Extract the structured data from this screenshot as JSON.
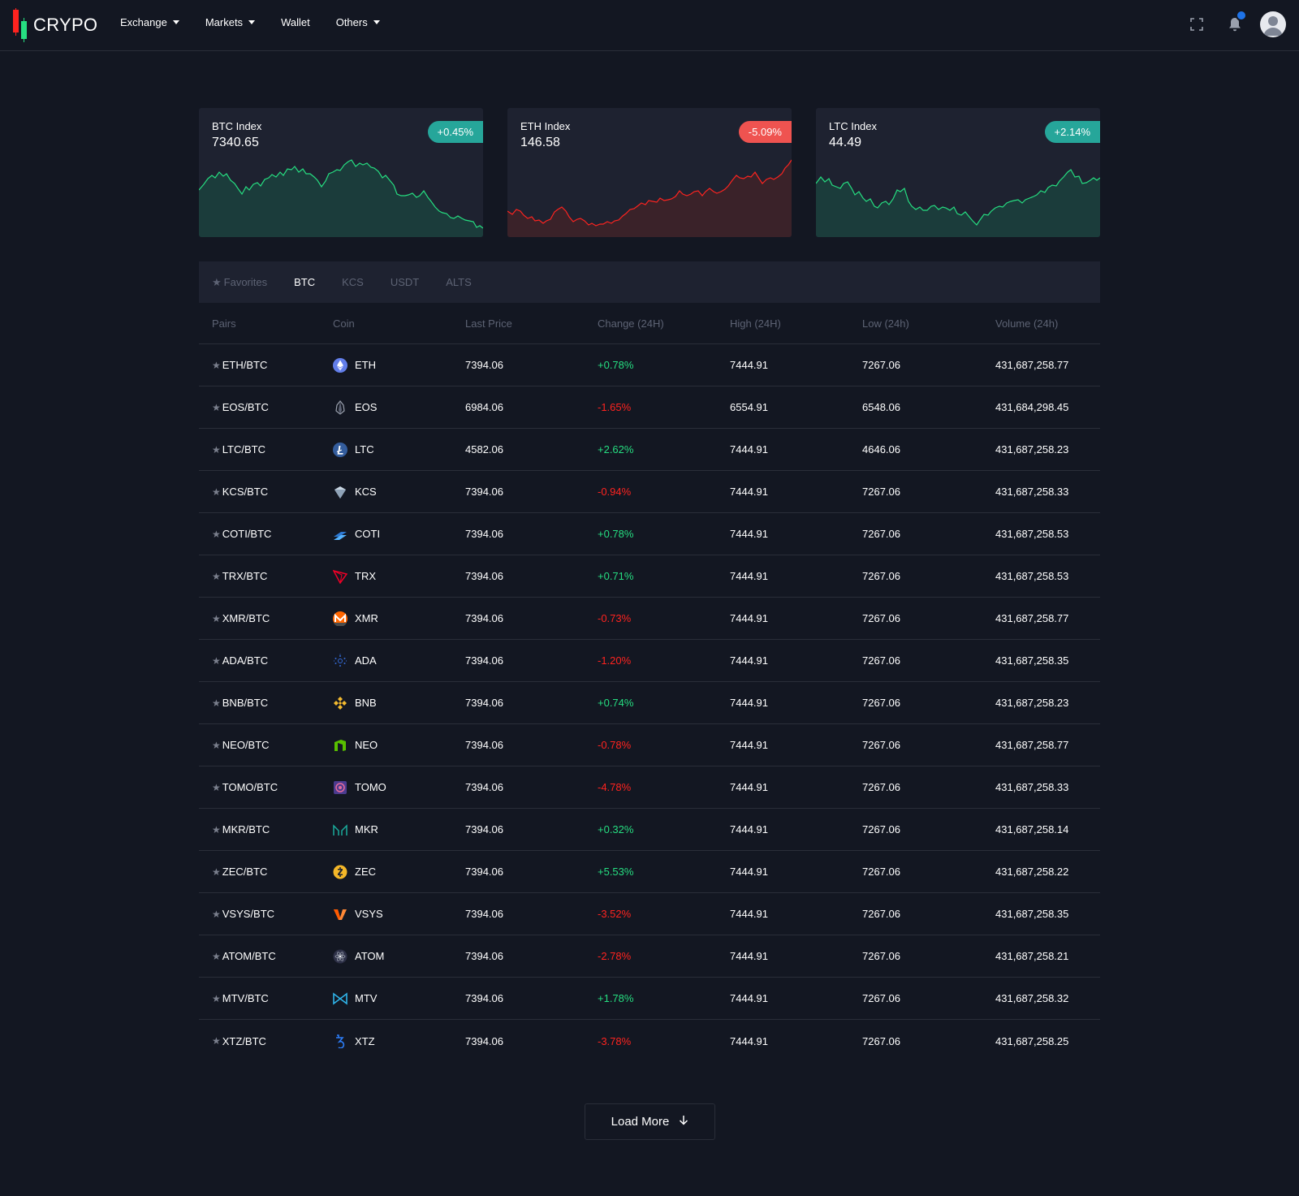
{
  "brand": {
    "name": "CRYPO",
    "red": "#ff231f",
    "green": "#26de81"
  },
  "nav": [
    {
      "label": "Exchange",
      "has_caret": true
    },
    {
      "label": "Markets",
      "has_caret": true
    },
    {
      "label": "Wallet",
      "has_caret": false
    },
    {
      "label": "Others",
      "has_caret": true
    }
  ],
  "header_icons": [
    "fullscreen-icon",
    "bell-icon",
    "user-avatar-icon"
  ],
  "index_cards": [
    {
      "title": "BTC Index",
      "value": "7340.65",
      "change": "+0.45%",
      "direction": "up",
      "color": "#26a69a"
    },
    {
      "title": "ETH Index",
      "value": "146.58",
      "change": "-5.09%",
      "direction": "down",
      "color": "#ef5350"
    },
    {
      "title": "LTC Index",
      "value": "44.49",
      "change": "+2.14%",
      "direction": "up",
      "color": "#26a69a"
    }
  ],
  "tabs": [
    {
      "label": "Favorites",
      "active": false,
      "icon": "star-icon"
    },
    {
      "label": "BTC",
      "active": true
    },
    {
      "label": "KCS",
      "active": false
    },
    {
      "label": "USDT",
      "active": false
    },
    {
      "label": "ALTS",
      "active": false
    }
  ],
  "table": {
    "columns": [
      "Pairs",
      "Coin",
      "Last Price",
      "Change (24H)",
      "High (24H)",
      "Low (24h)",
      "Volume (24h)"
    ],
    "rows": [
      {
        "pair": "ETH/BTC",
        "coin": "ETH",
        "icon": "eth-icon",
        "last": "7394.06",
        "change": "+0.78%",
        "dir": "pos",
        "high": "7444.91",
        "low": "7267.06",
        "volume": "431,687,258.77"
      },
      {
        "pair": "EOS/BTC",
        "coin": "EOS",
        "icon": "eos-icon",
        "last": "6984.06",
        "change": "-1.65%",
        "dir": "neg",
        "high": "6554.91",
        "low": "6548.06",
        "volume": "431,684,298.45"
      },
      {
        "pair": "LTC/BTC",
        "coin": "LTC",
        "icon": "ltc-icon",
        "last": "4582.06",
        "change": "+2.62%",
        "dir": "pos",
        "high": "7444.91",
        "low": "4646.06",
        "volume": "431,687,258.23"
      },
      {
        "pair": "KCS/BTC",
        "coin": "KCS",
        "icon": "kcs-icon",
        "last": "7394.06",
        "change": "-0.94%",
        "dir": "neg",
        "high": "7444.91",
        "low": "7267.06",
        "volume": "431,687,258.33"
      },
      {
        "pair": "COTI/BTC",
        "coin": "COTI",
        "icon": "coti-icon",
        "last": "7394.06",
        "change": "+0.78%",
        "dir": "pos",
        "high": "7444.91",
        "low": "7267.06",
        "volume": "431,687,258.53"
      },
      {
        "pair": "TRX/BTC",
        "coin": "TRX",
        "icon": "trx-icon",
        "last": "7394.06",
        "change": "+0.71%",
        "dir": "pos",
        "high": "7444.91",
        "low": "7267.06",
        "volume": "431,687,258.53"
      },
      {
        "pair": "XMR/BTC",
        "coin": "XMR",
        "icon": "xmr-icon",
        "last": "7394.06",
        "change": "-0.73%",
        "dir": "neg",
        "high": "7444.91",
        "low": "7267.06",
        "volume": "431,687,258.77"
      },
      {
        "pair": "ADA/BTC",
        "coin": "ADA",
        "icon": "ada-icon",
        "last": "7394.06",
        "change": "-1.20%",
        "dir": "neg",
        "high": "7444.91",
        "low": "7267.06",
        "volume": "431,687,258.35"
      },
      {
        "pair": "BNB/BTC",
        "coin": "BNB",
        "icon": "bnb-icon",
        "last": "7394.06",
        "change": "+0.74%",
        "dir": "pos",
        "high": "7444.91",
        "low": "7267.06",
        "volume": "431,687,258.23"
      },
      {
        "pair": "NEO/BTC",
        "coin": "NEO",
        "icon": "neo-icon",
        "last": "7394.06",
        "change": "-0.78%",
        "dir": "neg",
        "high": "7444.91",
        "low": "7267.06",
        "volume": "431,687,258.77"
      },
      {
        "pair": "TOMO/BTC",
        "coin": "TOMO",
        "icon": "tomo-icon",
        "last": "7394.06",
        "change": "-4.78%",
        "dir": "neg",
        "high": "7444.91",
        "low": "7267.06",
        "volume": "431,687,258.33"
      },
      {
        "pair": "MKR/BTC",
        "coin": "MKR",
        "icon": "mkr-icon",
        "last": "7394.06",
        "change": "+0.32%",
        "dir": "pos",
        "high": "7444.91",
        "low": "7267.06",
        "volume": "431,687,258.14"
      },
      {
        "pair": "ZEC/BTC",
        "coin": "ZEC",
        "icon": "zec-icon",
        "last": "7394.06",
        "change": "+5.53%",
        "dir": "pos",
        "high": "7444.91",
        "low": "7267.06",
        "volume": "431,687,258.22"
      },
      {
        "pair": "VSYS/BTC",
        "coin": "VSYS",
        "icon": "vsys-icon",
        "last": "7394.06",
        "change": "-3.52%",
        "dir": "neg",
        "high": "7444.91",
        "low": "7267.06",
        "volume": "431,687,258.35"
      },
      {
        "pair": "ATOM/BTC",
        "coin": "ATOM",
        "icon": "atom-icon",
        "last": "7394.06",
        "change": "-2.78%",
        "dir": "neg",
        "high": "7444.91",
        "low": "7267.06",
        "volume": "431,687,258.21"
      },
      {
        "pair": "MTV/BTC",
        "coin": "MTV",
        "icon": "mtv-icon",
        "last": "7394.06",
        "change": "+1.78%",
        "dir": "pos",
        "high": "7444.91",
        "low": "7267.06",
        "volume": "431,687,258.32"
      },
      {
        "pair": "XTZ/BTC",
        "coin": "XTZ",
        "icon": "xtz-icon",
        "last": "7394.06",
        "change": "-3.78%",
        "dir": "neg",
        "high": "7444.91",
        "low": "7267.06",
        "volume": "431,687,258.25"
      }
    ]
  },
  "load_more": {
    "label": "Load More",
    "icon": "arrow-down-icon"
  },
  "colors": {
    "background": "#131722",
    "panel": "#1e2230",
    "positive": "#26de81",
    "negative": "#ff231f",
    "muted": "#5d6374"
  }
}
